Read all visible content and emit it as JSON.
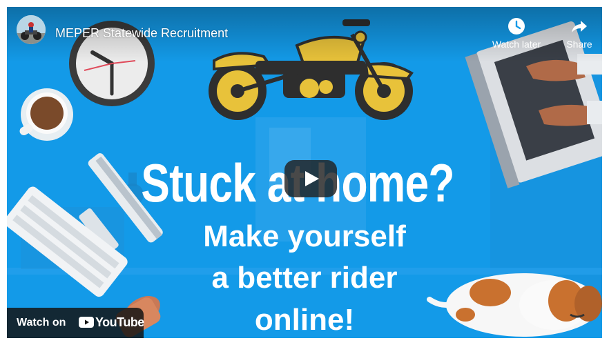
{
  "header": {
    "title": "MEPER Statewide Recruitment",
    "watch_later_label": "Watch later",
    "share_label": "Share"
  },
  "headline": {
    "line1": "Stuck at home?",
    "line2": "Make yourself",
    "line3": "a better rider",
    "line4": "online!"
  },
  "footer": {
    "watch_on_label": "Watch on",
    "youtube_label": "YouTube"
  },
  "icons": [
    "channel-avatar",
    "clock-icon",
    "share-icon",
    "play-icon",
    "youtube-logo-icon"
  ],
  "colors": {
    "background": "#139ae8",
    "motorcycle": "#e8c23a",
    "text": "#ffffff"
  }
}
